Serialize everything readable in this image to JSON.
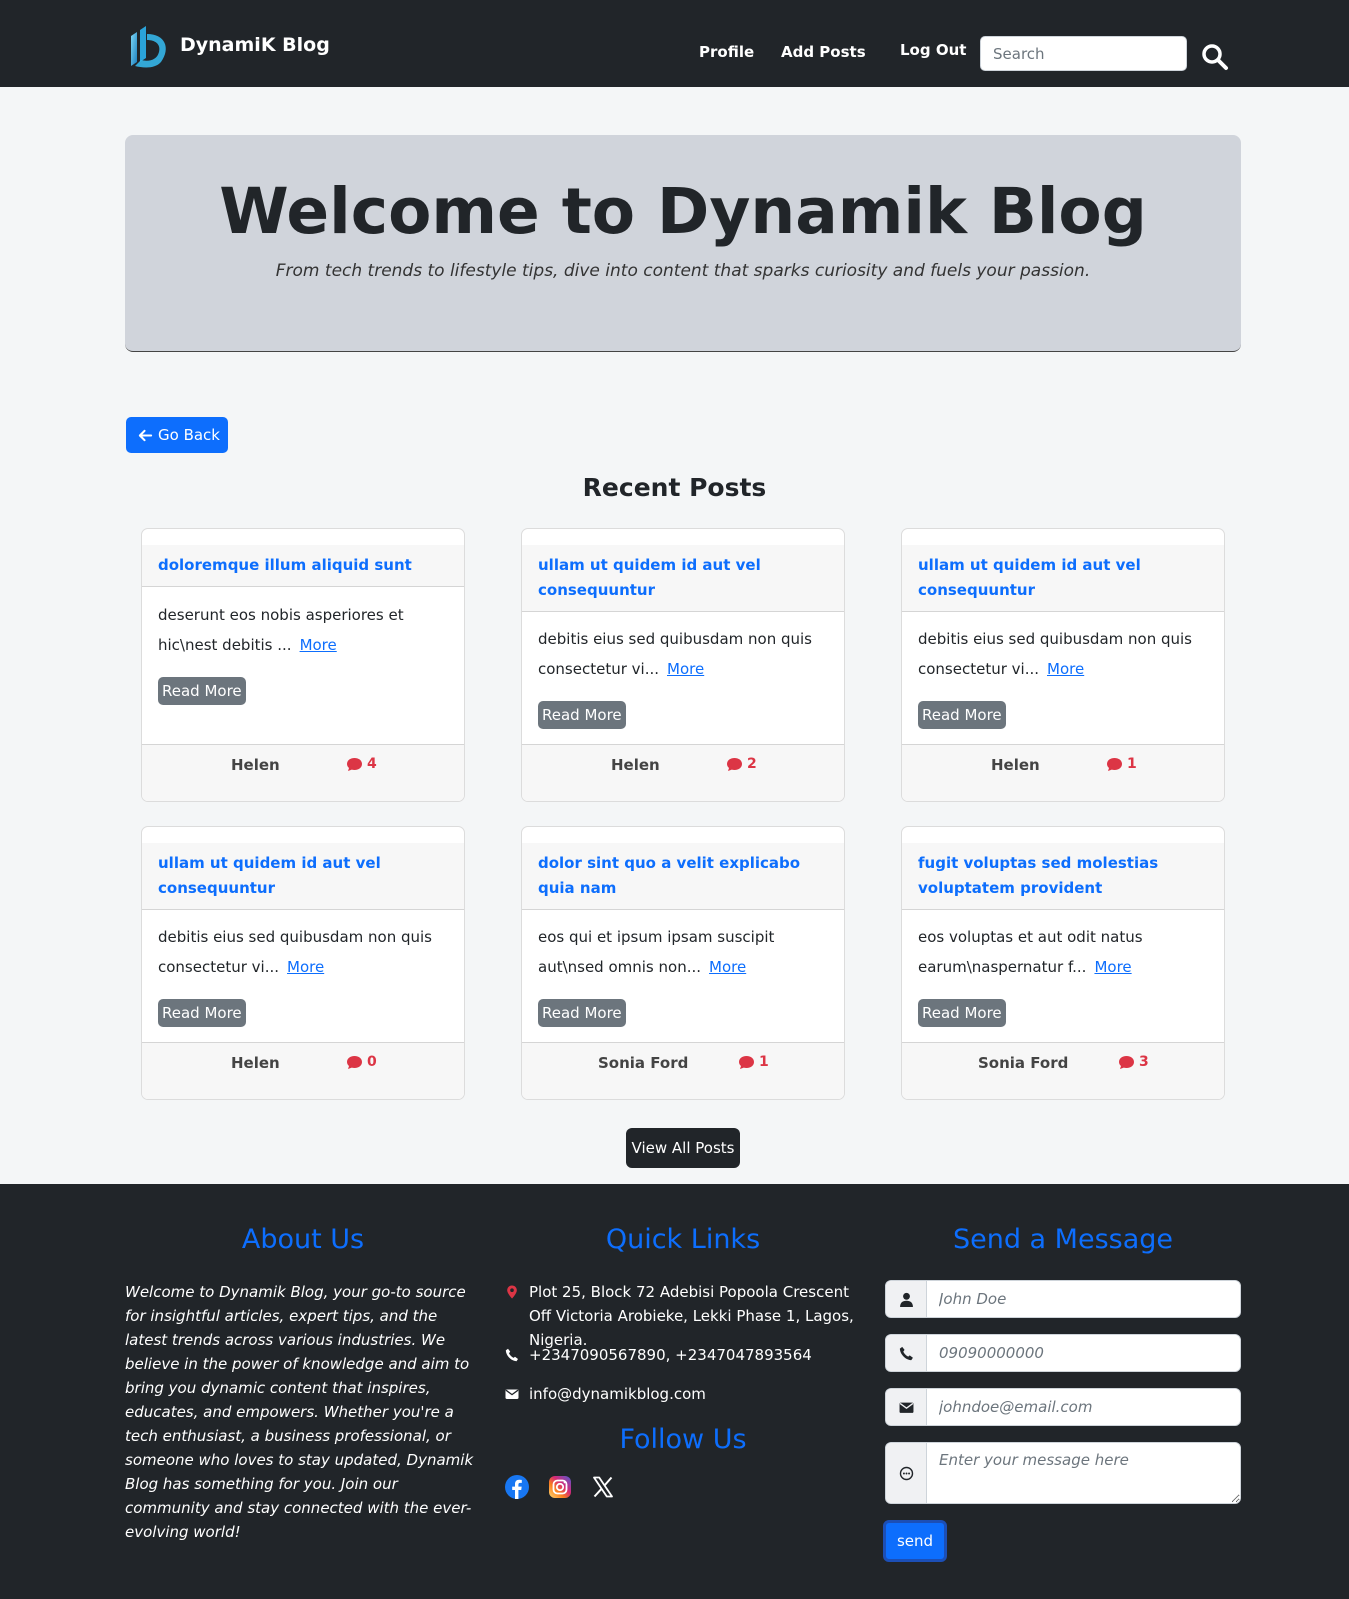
{
  "nav": {
    "brand": "DynamiK Blog",
    "links": [
      "Profile",
      "Add Posts",
      "Log Out"
    ],
    "search_placeholder": "Search"
  },
  "hero": {
    "title": "Welcome to Dynamik Blog",
    "subtitle": "From tech trends to lifestyle tips, dive into content that sparks curiosity and fuels your passion."
  },
  "go_back_label": "Go Back",
  "section_title": "Recent Posts",
  "posts": [
    {
      "title": "doloremque illum aliquid sunt",
      "excerpt": "deserunt eos nobis asperiores et hic\\nest debitis ...",
      "more": "More",
      "button": "Read More",
      "author": "Helen",
      "comments": "4"
    },
    {
      "title": "ullam ut quidem id aut vel consequuntur",
      "excerpt": "debitis eius sed quibusdam non quis consectetur vi...",
      "more": "More",
      "button": "Read More",
      "author": "Helen",
      "comments": "2"
    },
    {
      "title": "ullam ut quidem id aut vel consequuntur",
      "excerpt": "debitis eius sed quibusdam non quis consectetur vi...",
      "more": "More",
      "button": "Read More",
      "author": "Helen",
      "comments": "1"
    },
    {
      "title": "ullam ut quidem id aut vel consequuntur",
      "excerpt": "debitis eius sed quibusdam non quis consectetur vi...",
      "more": "More",
      "button": "Read More",
      "author": "Helen",
      "comments": "0"
    },
    {
      "title": "dolor sint quo a velit explicabo quia nam",
      "excerpt": "eos qui et ipsum ipsam suscipit aut\\nsed omnis non...",
      "more": "More",
      "button": "Read More",
      "author": "Sonia Ford",
      "comments": "1"
    },
    {
      "title": "fugit voluptas sed molestias voluptatem provident",
      "excerpt": "eos voluptas et aut odit natus earum\\naspernatur f...",
      "more": "More",
      "button": "Read More",
      "author": "Sonia Ford",
      "comments": "3"
    }
  ],
  "view_all_label": "View All Posts",
  "footer": {
    "about_heading": "About Us",
    "about_text": "Welcome to Dynamik Blog, your go-to source for insightful articles, expert tips, and the latest trends across various industries. We believe in the power of knowledge and aim to bring you dynamic content that inspires, educates, and empowers. Whether you're a tech enthusiast, a business professional, or someone who loves to stay updated, Dynamik Blog has something for you. Join our community and stay connected with the ever-evolving world!",
    "links_heading": "Quick Links",
    "address": "Plot 25, Block 72 Adebisi Popoola Crescent Off Victoria Arobieke, Lekki Phase 1, Lagos, Nigeria.",
    "phone": "+2347090567890, +2347047893564",
    "email": "info@dynamikblog.com",
    "follow_heading": "Follow Us",
    "social_icons": [
      "facebook-icon",
      "instagram-icon",
      "x-icon"
    ],
    "message_heading": "Send a Message",
    "form": {
      "name_placeholder": "John Doe",
      "phone_placeholder": "09090000000",
      "email_placeholder": "johndoe@email.com",
      "message_placeholder": "Enter your message here",
      "send_label": "send"
    }
  },
  "colors": {
    "navbar": "#212529",
    "primary": "#0d6efd",
    "hero_bg": "#d0d4db",
    "read_more": "#6c757d",
    "comments": "#dc3545"
  }
}
